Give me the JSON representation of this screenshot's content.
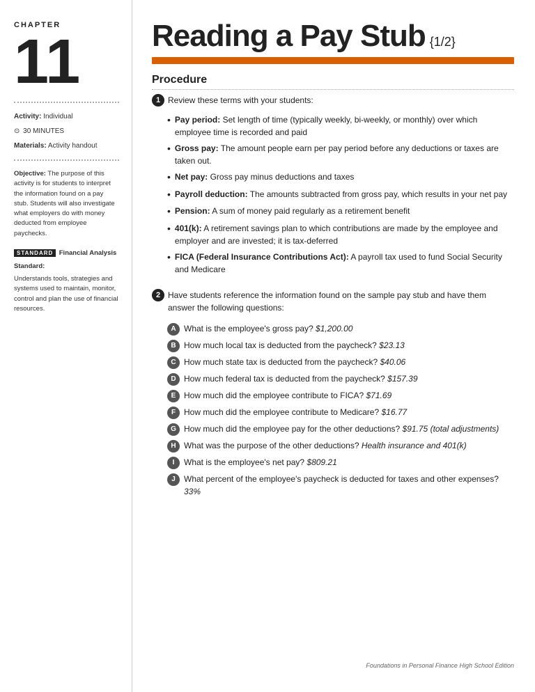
{
  "sidebar": {
    "chapter_label": "CHAPTER",
    "chapter_number": "11",
    "activity_label": "Activity:",
    "activity_value": "Individual",
    "time_icon": "⊙",
    "time_value": "30 MINUTES",
    "materials_label": "Materials:",
    "materials_value": "Activity handout",
    "objective_label": "Objective:",
    "objective_text": "The purpose of this activity is for students to interpret the information found on a pay stub. Students will also investigate what employers do with money deducted from employee paychecks.",
    "standard_badge": "STANDARD",
    "standard_title": "Financial Analysis Standard:",
    "standard_text": "Understands tools, strategies and systems used to maintain, monitor, control and plan the use of financial resources."
  },
  "main": {
    "title": "Reading a Pay Stub",
    "fraction": "{1/2}",
    "section_title": "Procedure",
    "step1_intro": "Review these terms with your students:",
    "terms": [
      {
        "term": "Pay period:",
        "definition": "Set length of time (typically weekly, bi-weekly, or monthly) over which employee time is recorded and paid"
      },
      {
        "term": "Gross pay:",
        "definition": "The amount people earn per pay period before any deductions or taxes are taken out."
      },
      {
        "term": "Net pay:",
        "definition": "Gross pay minus deductions and taxes"
      },
      {
        "term": "Payroll deduction:",
        "definition": "The amounts subtracted from gross pay, which results in your net pay"
      },
      {
        "term": "Pension:",
        "definition": "A sum of money paid regularly as a retirement benefit"
      },
      {
        "term": "401(k):",
        "definition": "A retirement savings plan to which contributions are made by the employee and employer and are invested; it is tax-deferred"
      },
      {
        "term": "FICA (Federal Insurance Contributions Act):",
        "definition": "A payroll tax used to fund Social Security and Medicare"
      }
    ],
    "step2_intro": "Have students reference the information found on the sample pay stub and have them answer the following questions:",
    "sub_questions": [
      {
        "letter": "A",
        "question": "What is the employee's gross pay?",
        "answer": "$1,200.00"
      },
      {
        "letter": "B",
        "question": "How much local tax is deducted from the paycheck?",
        "answer": "$23.13"
      },
      {
        "letter": "C",
        "question": "How much state tax is deducted from the paycheck?",
        "answer": "$40.06"
      },
      {
        "letter": "D",
        "question": "How much federal tax is deducted from the paycheck?",
        "answer": "$157.39"
      },
      {
        "letter": "E",
        "question": "How much did the employee contribute to FICA?",
        "answer": "$71.69"
      },
      {
        "letter": "F",
        "question": "How much did the employee contribute to Medicare?",
        "answer": "$16.77"
      },
      {
        "letter": "G",
        "question": "How much did the employee pay for the other deductions?",
        "answer": "$91.75 (total adjustments)"
      },
      {
        "letter": "H",
        "question": "What was the purpose of the other deductions?",
        "answer": "Health insurance and 401(k)"
      },
      {
        "letter": "I",
        "question": "What is the employee's net pay?",
        "answer": "$809.21"
      },
      {
        "letter": "J",
        "question": "What percent of the employee's paycheck is deducted for taxes and other expenses?",
        "answer": "33%"
      }
    ]
  },
  "footer": {
    "text": "Foundations in Personal Finance High School Edition"
  }
}
